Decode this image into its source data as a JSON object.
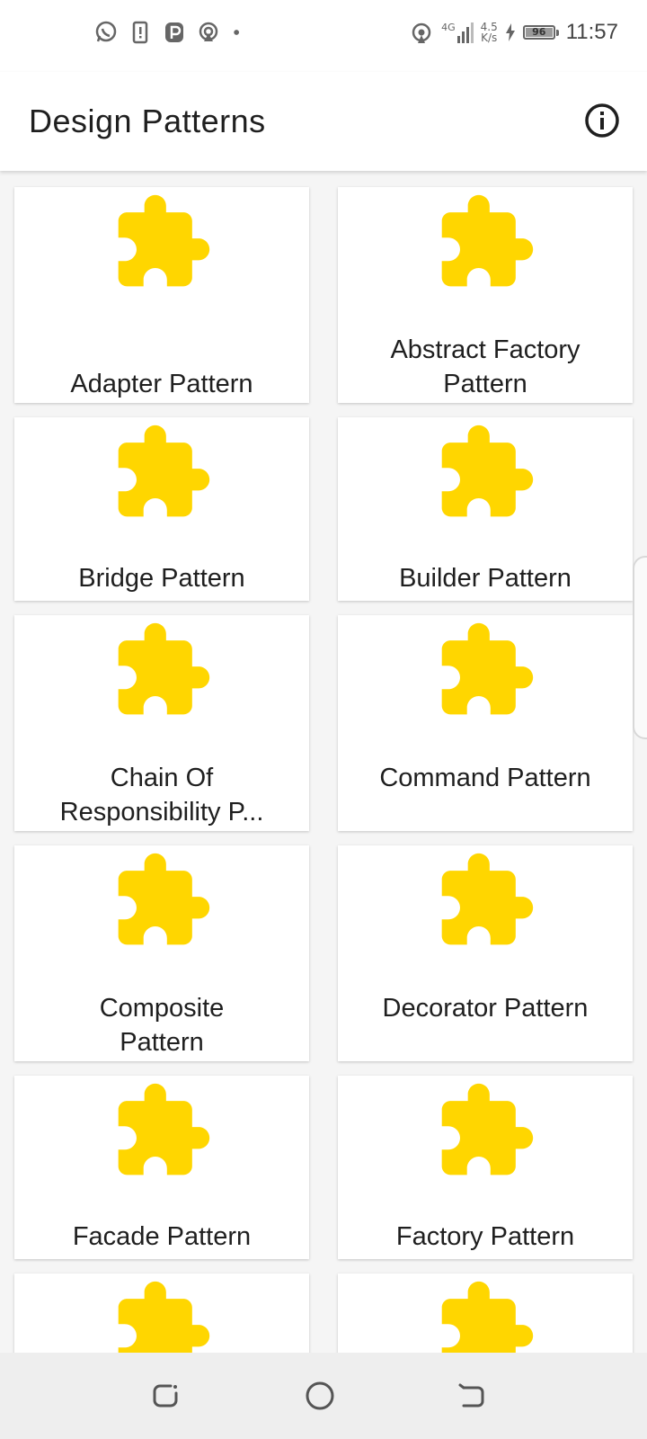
{
  "status_bar": {
    "time": "11:57",
    "network_speed_value": "4.5",
    "network_speed_unit": "K/s",
    "network_type": "4G",
    "battery_level": "96",
    "left_icons": [
      "whatsapp-icon",
      "sim-notification-icon",
      "p-app-icon",
      "hotspot-icon",
      "dot-icon"
    ]
  },
  "app_bar": {
    "title": "Design Patterns",
    "info_icon": "info-icon"
  },
  "patterns": [
    {
      "label": "Adapter Pattern"
    },
    {
      "label": "Abstract Factory Pattern"
    },
    {
      "label": "Bridge Pattern"
    },
    {
      "label": "Builder Pattern"
    },
    {
      "label": "Chain Of Responsibility P..."
    },
    {
      "label": "Command Pattern"
    },
    {
      "label": "Composite Pattern"
    },
    {
      "label": "Decorator Pattern"
    },
    {
      "label": "Facade Pattern"
    },
    {
      "label": "Factory Pattern"
    },
    {
      "label": ""
    },
    {
      "label": ""
    }
  ],
  "colors": {
    "puzzle": "#FFD600",
    "background": "#F5F5F5",
    "card": "#FFFFFF"
  },
  "nav_bar": {
    "icons": [
      "recent-apps-icon",
      "home-icon",
      "back-icon"
    ]
  }
}
